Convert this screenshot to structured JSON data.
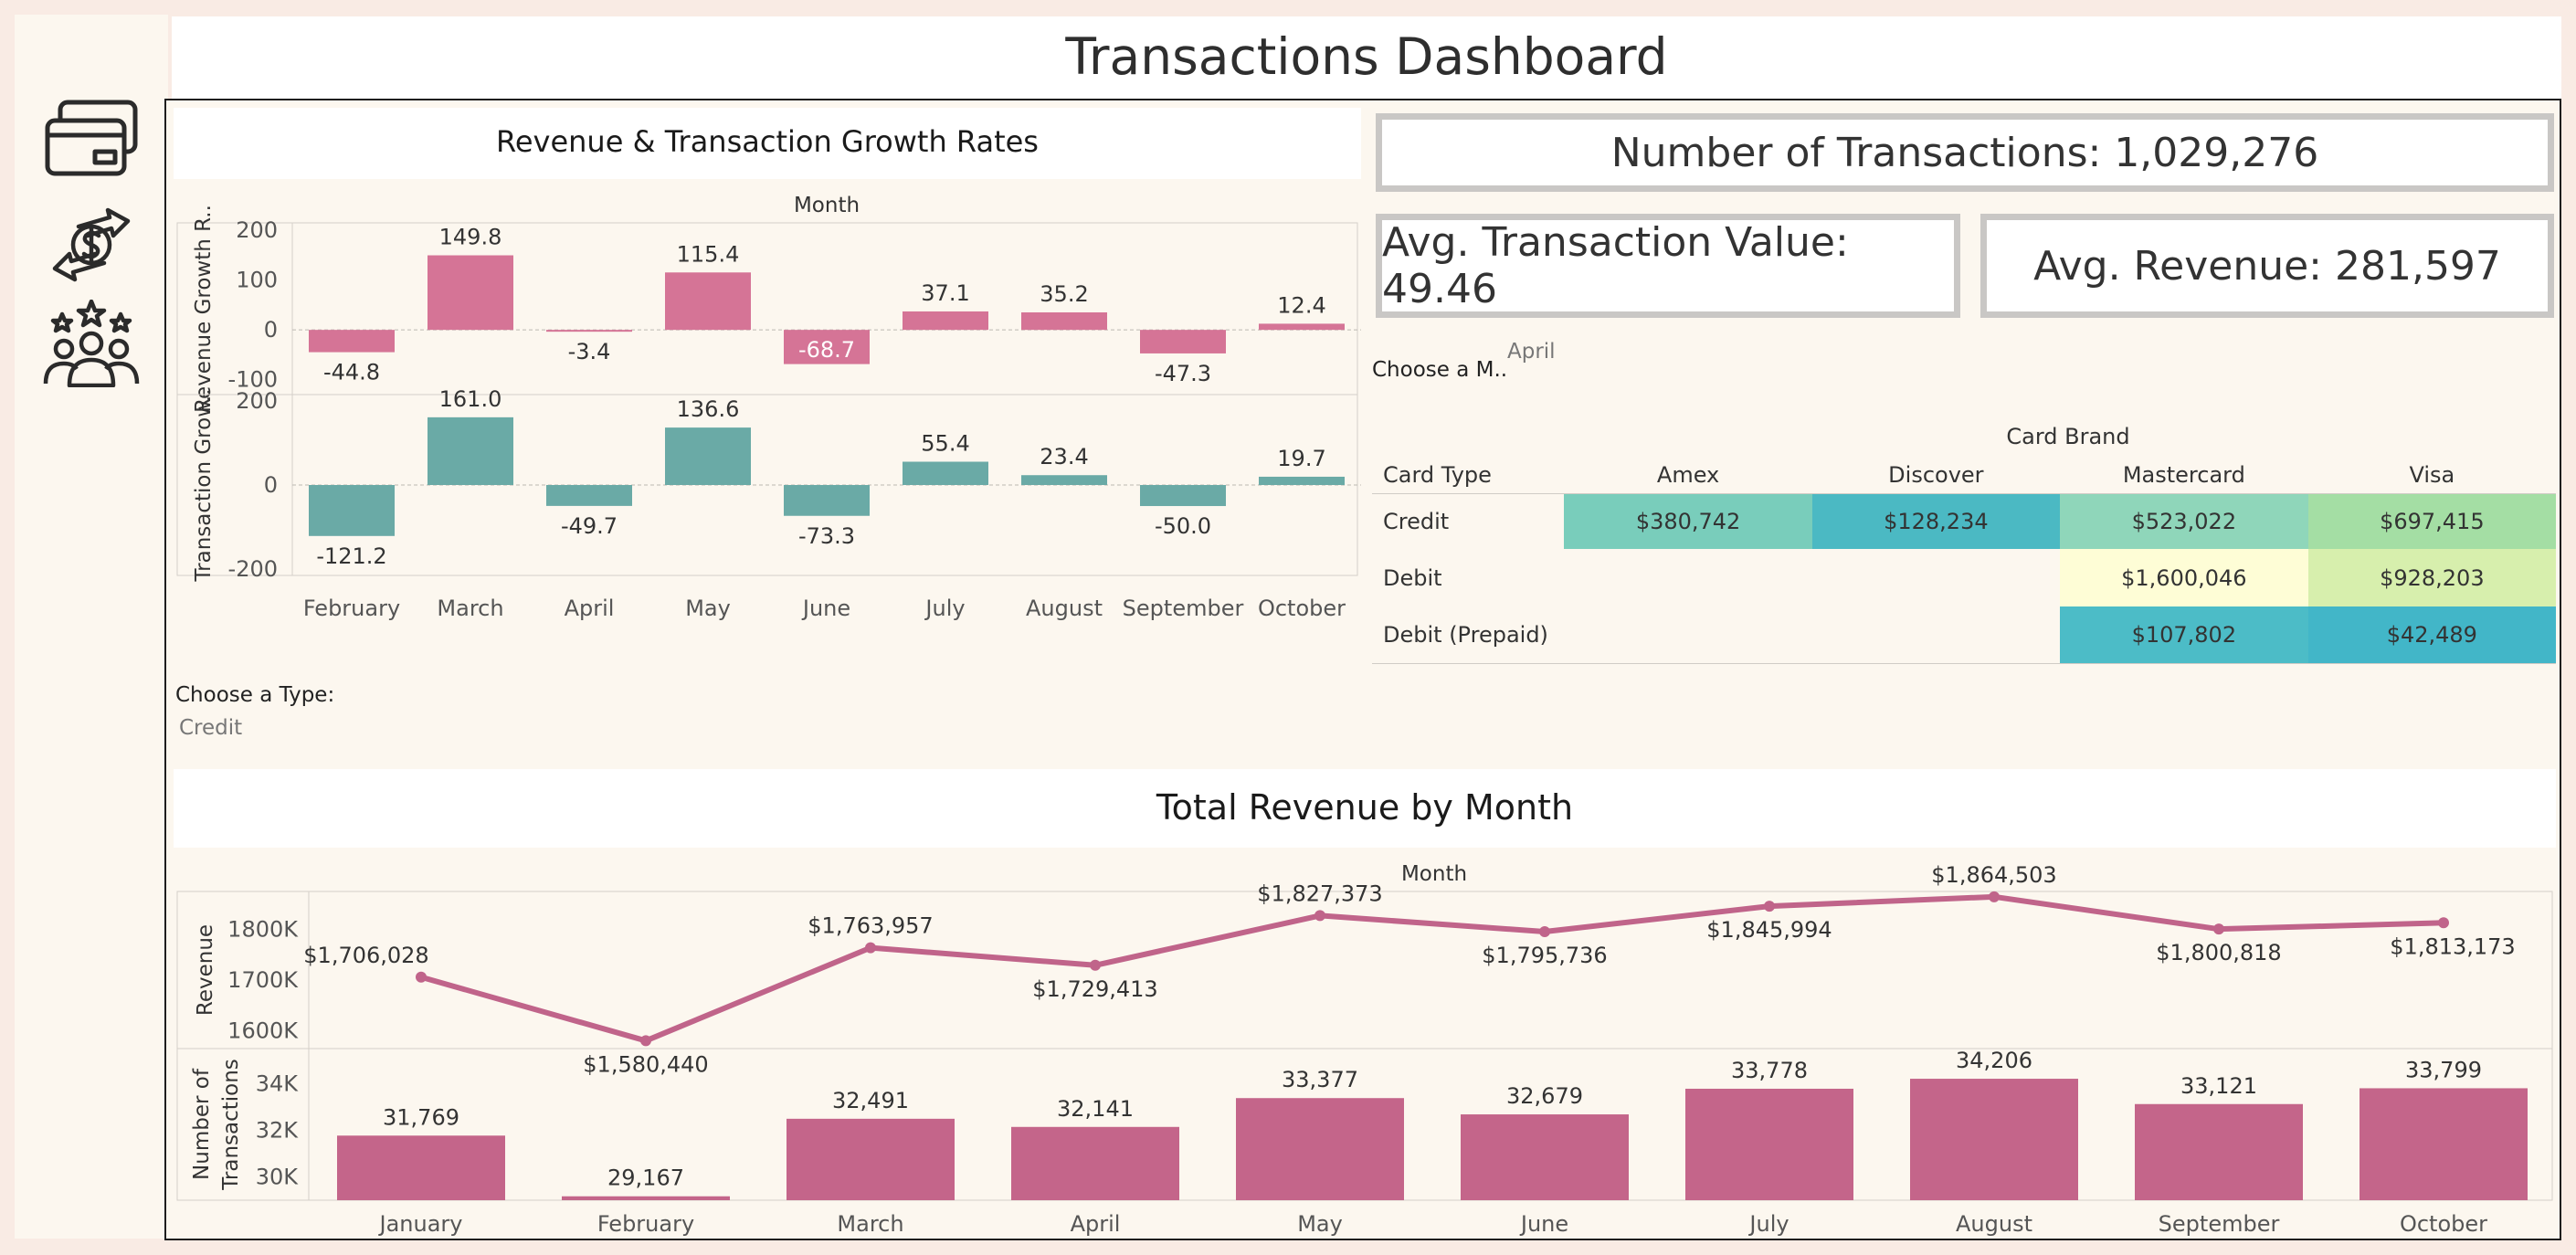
{
  "dashboard": {
    "title": "Transactions Dashboard"
  },
  "sidebar": {
    "icons": [
      "credit-card-icon",
      "currency-exchange-icon",
      "customer-rating-icon"
    ]
  },
  "kpis": {
    "transactions": "Number of Transactions: 1,029,276",
    "avg_value": "Avg. Transaction Value: 49.46",
    "avg_revenue": "Avg. Revenue: 281,597"
  },
  "growth_panel": {
    "title": "Revenue & Transaction Growth Rates",
    "header": "Month",
    "type_filter_label": "Choose a Type:",
    "type_filter_value": "Credit"
  },
  "month_filter": {
    "label": "Choose a M..",
    "value": "April"
  },
  "heatmap": {
    "brand_header": "Card Brand",
    "type_header": "Card Type",
    "columns": [
      "Amex",
      "Discover",
      "Mastercard",
      "Visa"
    ],
    "rows": [
      {
        "label": "Credit",
        "cells": [
          "$380,742",
          "$128,234",
          "$523,022",
          "$697,415"
        ],
        "colors": [
          "#79cdbb",
          "#4bb9c3",
          "#8fd6ba",
          "#a4dea4"
        ]
      },
      {
        "label": "Debit",
        "cells": [
          "",
          "",
          "$1,600,046",
          "$928,203"
        ],
        "colors": [
          "",
          "",
          "#fefdd6",
          "#d7efad"
        ]
      },
      {
        "label": "Debit (Prepaid)",
        "cells": [
          "",
          "",
          "$107,802",
          "$42,489"
        ],
        "colors": [
          "",
          "",
          "#4cbcc7",
          "#42b6c8"
        ]
      }
    ]
  },
  "revenue_panel": {
    "title": "Total Revenue by Month",
    "header": "Month"
  },
  "chart_data": [
    {
      "type": "bar",
      "categories": [
        "February",
        "March",
        "April",
        "May",
        "June",
        "July",
        "August",
        "September",
        "October"
      ],
      "series": [
        {
          "values": [
            -44.8,
            149.8,
            -3.4,
            115.4,
            -68.7,
            37.1,
            35.2,
            -47.3,
            12.4
          ],
          "color": "#d57496"
        },
        {
          "values": [
            -121.2,
            161.0,
            -49.7,
            136.6,
            -73.3,
            55.4,
            23.4,
            -50.0,
            19.7
          ],
          "color": "#6aaaa6"
        }
      ],
      "ylabels": [
        "Revenue Growth R..",
        "Transaction Grow.."
      ],
      "yticks": [
        [
          200,
          100,
          0,
          -100
        ],
        [
          200,
          0,
          -200
        ]
      ],
      "ylims": [
        [
          -130,
          215
        ],
        [
          -215,
          215
        ]
      ]
    },
    {
      "type": "line",
      "categories": [
        "January",
        "February",
        "March",
        "April",
        "May",
        "June",
        "July",
        "August",
        "September",
        "October"
      ],
      "values": [
        1706028,
        1580440,
        1763957,
        1729413,
        1827373,
        1795736,
        1845994,
        1864503,
        1800818,
        1813173
      ],
      "labels": [
        "$1,706,028",
        "$1,580,440",
        "$1,763,957",
        "$1,729,413",
        "$1,827,373",
        "$1,795,736",
        "$1,845,994",
        "$1,864,503",
        "$1,800,818",
        "$1,813,173"
      ],
      "ylabel": "Revenue",
      "yticks": [
        "1800K",
        "1700K",
        "1600K"
      ],
      "ytick_values": [
        1800000,
        1700000,
        1600000
      ],
      "ylim": [
        1565000,
        1875000
      ],
      "color": "#c0648a"
    },
    {
      "type": "bar",
      "categories": [
        "January",
        "February",
        "March",
        "April",
        "May",
        "June",
        "July",
        "August",
        "September",
        "October"
      ],
      "values": [
        31769,
        29167,
        32491,
        32141,
        33377,
        32679,
        33778,
        34206,
        33121,
        33799
      ],
      "labels": [
        "31,769",
        "29,167",
        "32,491",
        "32,141",
        "33,377",
        "32,679",
        "33,778",
        "34,206",
        "33,121",
        "33,799"
      ],
      "ylabel": [
        "Number of",
        "Transactions"
      ],
      "yticks": [
        "34K",
        "32K",
        "30K"
      ],
      "ytick_values": [
        34000,
        32000,
        30000
      ],
      "ylim": [
        29000,
        35500
      ],
      "color": "#c4658a"
    }
  ]
}
